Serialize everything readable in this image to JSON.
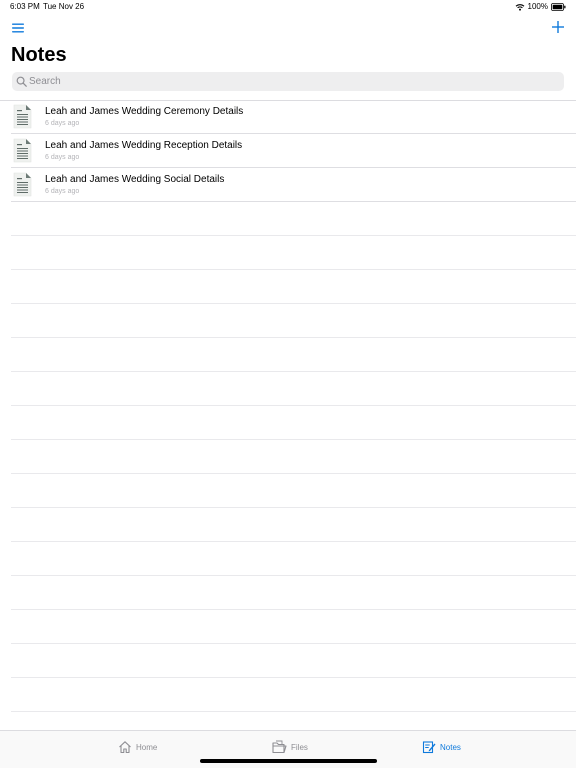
{
  "status_bar": {
    "time": "6:03 PM",
    "date": "Tue Nov 26",
    "battery": "100%"
  },
  "nav": {
    "menu_icon": "hamburger-menu-icon",
    "add_icon": "plus-icon"
  },
  "page": {
    "title": "Notes"
  },
  "search": {
    "placeholder": "Search",
    "value": ""
  },
  "notes": [
    {
      "title": "Leah and James Wedding Ceremony Details",
      "time": "6 days ago"
    },
    {
      "title": "Leah and James Wedding Reception Details",
      "time": "6 days ago"
    },
    {
      "title": "Leah and James Wedding Social Details",
      "time": "6 days ago"
    }
  ],
  "tabs": [
    {
      "label": "Home",
      "icon": "house-icon"
    },
    {
      "label": "Files",
      "icon": "folder-icon"
    },
    {
      "label": "Notes",
      "icon": "note-edit-icon",
      "active": true
    }
  ],
  "colors": {
    "accent": "#0F7ADC",
    "tab_inactive": "#8E8E93",
    "search_background": "#EEEEEF"
  }
}
